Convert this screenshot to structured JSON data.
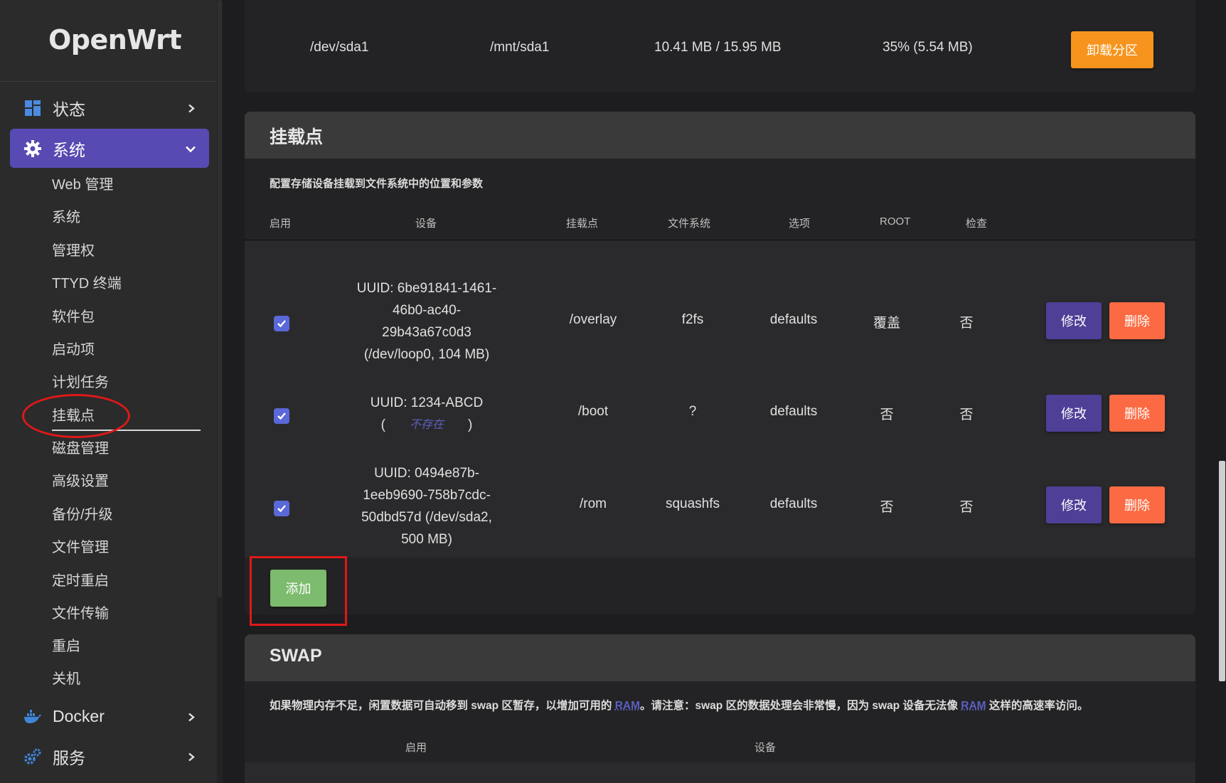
{
  "sidebar": {
    "logo": "OpenWrt",
    "top_items": [
      {
        "label": "状态",
        "icon": "dashboard-icon"
      },
      {
        "label": "系统",
        "icon": "gear-icon"
      },
      {
        "label": "Docker",
        "icon": "docker-icon"
      },
      {
        "label": "服务",
        "icon": "services-gear-icon"
      }
    ],
    "system_subitems": [
      "Web 管理",
      "系统",
      "管理权",
      "TTYD 终端",
      "软件包",
      "启动项",
      "计划任务",
      "挂载点",
      "磁盘管理",
      "高级设置",
      "备份/升级",
      "文件管理",
      "定时重启",
      "文件传输",
      "重启",
      "关机"
    ],
    "active_subitem": "挂载点"
  },
  "partition": {
    "device": "/dev/sda1",
    "mount": "/mnt/sda1",
    "size": "10.41 MB / 15.95 MB",
    "usage": "35% (5.54 MB)",
    "unmount_label": "卸载分区"
  },
  "mounts": {
    "title": "挂载点",
    "description": "配置存储设备挂载到文件系统中的位置和参数",
    "headers": [
      "启用",
      "设备",
      "挂载点",
      "文件系统",
      "选项",
      "ROOT",
      "检查"
    ],
    "rows": [
      {
        "enabled": true,
        "device_lines": [
          "UUID: 6be91841-1461-",
          "46b0-ac40-",
          "29b43a67c0d3",
          "(/dev/loop0, 104 MB)"
        ],
        "mountpoint": "/overlay",
        "fs": "f2fs",
        "options": "defaults",
        "root": "覆盖",
        "check": "否"
      },
      {
        "enabled": true,
        "device_lines": [
          "UUID: 1234-ABCD"
        ],
        "device_missing_open": "(",
        "device_missing_text": "不存在",
        "device_missing_close": ")",
        "mountpoint": "/boot",
        "fs": "?",
        "options": "defaults",
        "root": "否",
        "check": "否"
      },
      {
        "enabled": true,
        "device_lines": [
          "UUID: 0494e87b-",
          "1eeb9690-758b7cdc-",
          "50dbd57d (/dev/sda2,",
          "500 MB)"
        ],
        "mountpoint": "/rom",
        "fs": "squashfs",
        "options": "defaults",
        "root": "否",
        "check": "否"
      }
    ],
    "edit_label": "修改",
    "delete_label": "删除",
    "add_label": "添加"
  },
  "swap": {
    "title": "SWAP",
    "desc_part1": "如果物理内存不足，闲置数据可自动移到 swap 区暂存，以增加可用的 ",
    "desc_link1": "RAM",
    "desc_part2": "。请注意：swap 区的数据处理会非常慢，因为 swap 设备无法像 ",
    "desc_link2": "RAM",
    "desc_part3": " 这样的高速率访问。",
    "headers": [
      "启用",
      "设备"
    ]
  },
  "colors": {
    "accent": "#574ab2",
    "orange": "#f7941d",
    "delete": "#fb6a42",
    "edit": "#4f3f97",
    "add": "#7dbb6e",
    "annotation": "#e01818"
  }
}
